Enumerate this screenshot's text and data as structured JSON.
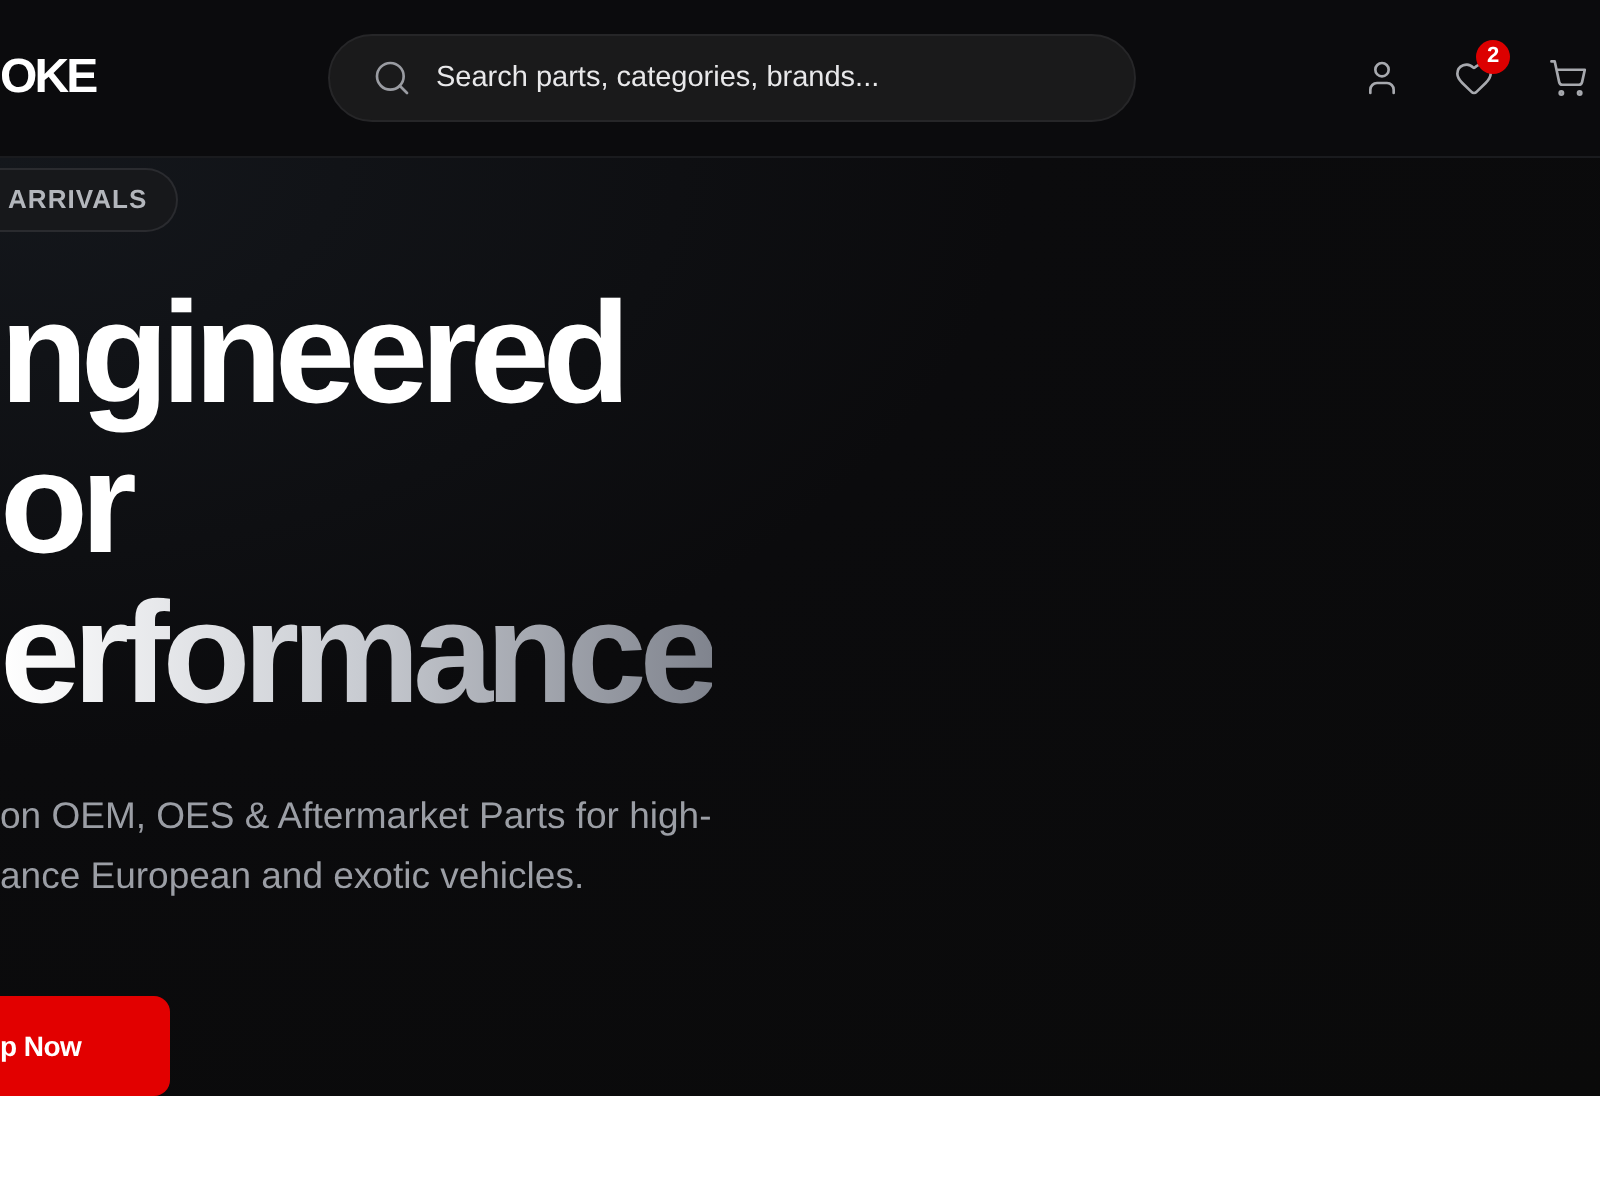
{
  "header": {
    "logo": "OKE",
    "search": {
      "placeholder": "Search parts, categories, brands..."
    },
    "wishlist_badge": "2"
  },
  "hero": {
    "badge": "ARRIVALS",
    "headline": [
      {
        "text": "ngineered",
        "kind": "solid"
      },
      {
        "text": "or",
        "kind": "solid"
      },
      {
        "text": "erformance",
        "kind": "gradient"
      }
    ],
    "description_lines": [
      "on OEM, OES & Aftermarket Parts for high-",
      "ance European and exotic vehicles."
    ],
    "cta": "p Now"
  }
}
